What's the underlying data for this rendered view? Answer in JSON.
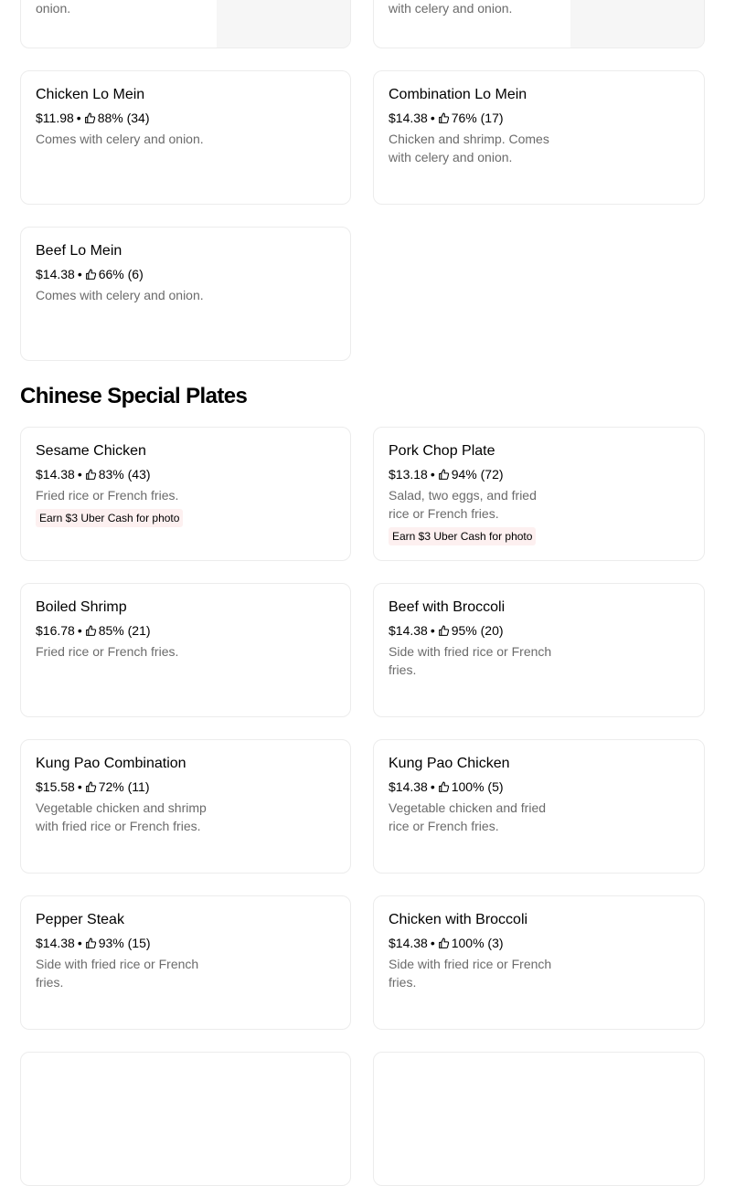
{
  "top_cards": [
    {
      "desc": "onion."
    },
    {
      "desc": "with celery and onion."
    }
  ],
  "lo_mein_items": [
    {
      "name": "Chicken Lo Mein",
      "price": "$11.98",
      "rating": "88% (34)",
      "desc": "Comes with celery and onion."
    },
    {
      "name": "Combination Lo Mein",
      "price": "$14.38",
      "rating": "76% (17)",
      "desc": "Chicken and shrimp. Comes with celery and onion."
    },
    {
      "name": "Beef Lo Mein",
      "price": "$14.38",
      "rating": "66% (6)",
      "desc": "Comes with celery and onion."
    }
  ],
  "special_section": {
    "title": "Chinese Special Plates",
    "items": [
      {
        "name": "Sesame Chicken",
        "price": "$14.38",
        "rating": "83% (43)",
        "desc": "Fried rice or French fries.",
        "promo": "Earn $3 Uber Cash for photo"
      },
      {
        "name": "Pork Chop Plate",
        "price": "$13.18",
        "rating": "94% (72)",
        "desc": "Salad, two eggs, and fried rice or French fries.",
        "promo": "Earn $3 Uber Cash for photo"
      },
      {
        "name": "Boiled Shrimp",
        "price": "$16.78",
        "rating": "85% (21)",
        "desc": "Fried rice or French fries."
      },
      {
        "name": "Beef with Broccoli",
        "price": "$14.38",
        "rating": "95% (20)",
        "desc": "Side with fried rice or French fries."
      },
      {
        "name": "Kung Pao Combination",
        "price": "$15.58",
        "rating": "72% (11)",
        "desc": "Vegetable chicken and shrimp with fried rice or French fries."
      },
      {
        "name": "Kung Pao Chicken",
        "price": "$14.38",
        "rating": "100% (5)",
        "desc": "Vegetable chicken and fried rice or French fries."
      },
      {
        "name": "Pepper Steak",
        "price": "$14.38",
        "rating": "93% (15)",
        "desc": "Side with fried rice or French fries."
      },
      {
        "name": "Chicken with Broccoli",
        "price": "$14.38",
        "rating": "100% (3)",
        "desc": "Side with fried rice or French fries."
      }
    ]
  },
  "meta_separator": "•",
  "icons": {
    "rating": "thumbs-up-icon"
  },
  "colors": {
    "description": "#6b6b6b",
    "promo_background": "#fdf0f0",
    "card_border": "#ececec",
    "image_placeholder": "#f6f6f6"
  }
}
